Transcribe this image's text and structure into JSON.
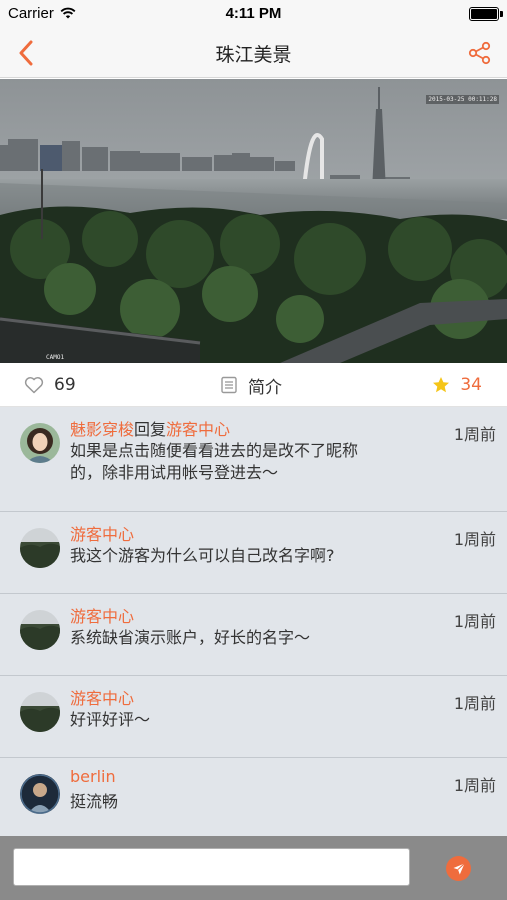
{
  "status_bar": {
    "carrier": "Carrier",
    "time": "4:11 PM",
    "wifi_icon": "wifi-icon",
    "battery_icon": "battery-icon"
  },
  "nav": {
    "title": "珠江美景",
    "back_icon": "chevron-left-icon",
    "share_icon": "share-icon",
    "accent_color": "#ef6c3d"
  },
  "hero_image": {
    "description_icon": "city-river-camera-view",
    "timestamp": "2015-03-25 00:11:28",
    "camera_label": "CAMO1"
  },
  "stats": {
    "likes": "69",
    "intro_label": "简介",
    "favorites": "34",
    "like_icon": "heart-icon",
    "intro_icon": "document-icon",
    "fav_icon": "star-icon"
  },
  "comments": [
    {
      "name": "魅影穿梭",
      "reply_word": "回复",
      "reply_to": "游客中心",
      "time": "1周前",
      "text": "如果是点击随便看看进去的是改不了昵称的，除非用试用帐号登进去～",
      "avatar": "girl-avatar"
    },
    {
      "name": "游客中心",
      "time": "1周前",
      "text": "我这个游客为什么可以自己改名字啊?",
      "avatar": "landscape-avatar"
    },
    {
      "name": "游客中心",
      "time": "1周前",
      "text": "系统缺省演示账户，好长的名字～",
      "avatar": "landscape-avatar"
    },
    {
      "name": "游客中心",
      "time": "1周前",
      "text": "好评好评～",
      "avatar": "landscape-avatar"
    },
    {
      "name": "berlin",
      "time": "1周前",
      "text": "挺流畅",
      "avatar": "man-avatar"
    }
  ],
  "input": {
    "placeholder": "",
    "send_icon": "send-icon"
  }
}
